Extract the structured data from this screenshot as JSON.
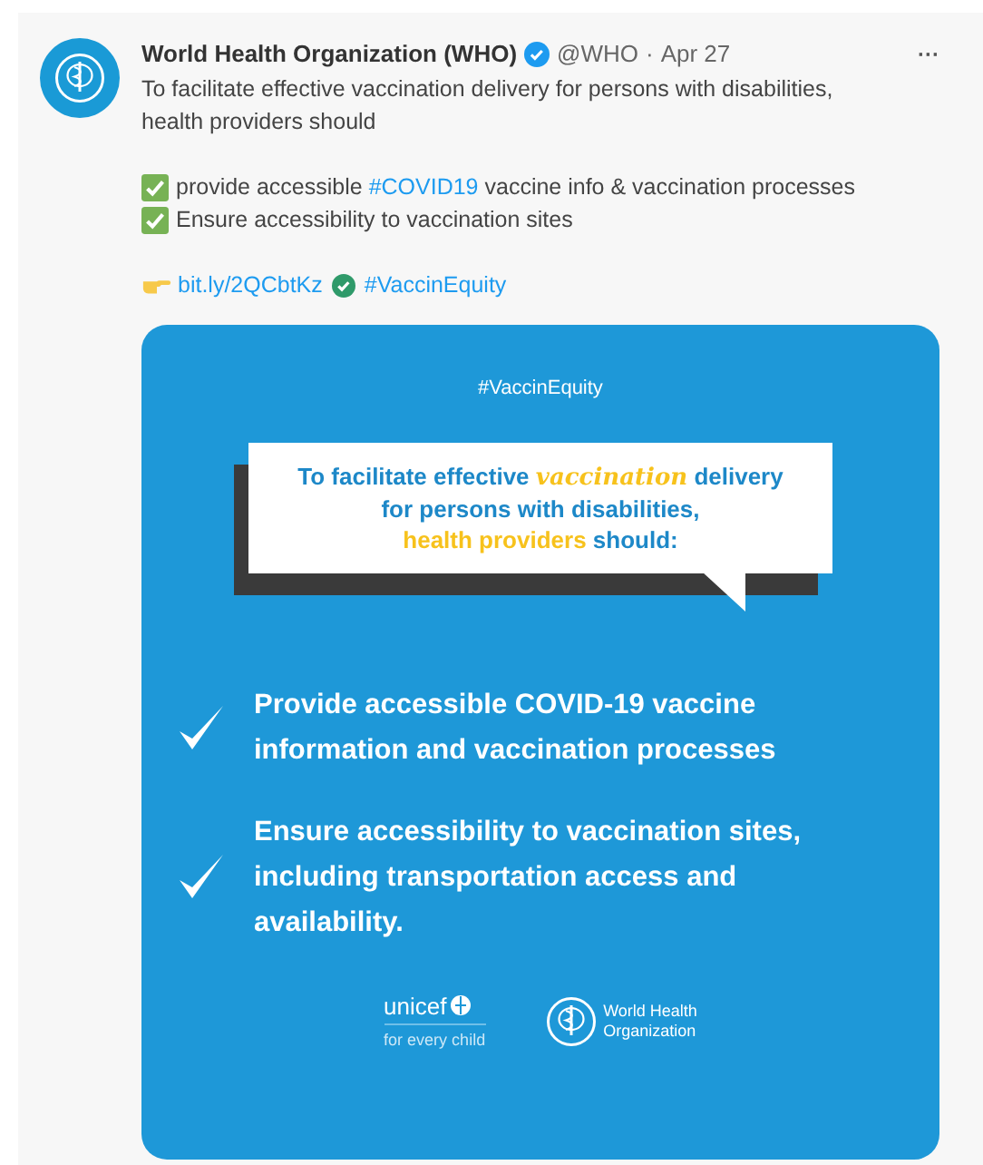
{
  "tweet": {
    "author": "World Health Organization (WHO)",
    "verified": true,
    "handle": "@WHO",
    "separator": "·",
    "date": "Apr 27",
    "more": "···",
    "intro": "To facilitate effective vaccination delivery for persons with disabilities, health providers should",
    "checklist": [
      [
        {
          "kind": "plain",
          "text": "provide accessible "
        },
        {
          "kind": "hashtag",
          "text": "#COVID19"
        },
        {
          "kind": "plain",
          "text": " vaccine info & vaccination processes"
        }
      ],
      [
        {
          "kind": "plain",
          "text": "Ensure accessibility to vaccination sites"
        }
      ]
    ],
    "link": "bit.ly/2QCbtKz",
    "hashtag": "#VaccinEquity"
  },
  "graphic": {
    "hashtag": "#VaccinEquity",
    "bubble_lines": [
      [
        {
          "kind": "plain",
          "text": "To facilitate effective "
        },
        {
          "kind": "script",
          "text": "vaccination"
        },
        {
          "kind": "plain",
          "text": " delivery"
        }
      ],
      [
        {
          "kind": "plain",
          "text": "for persons with disabilities,"
        }
      ],
      [
        {
          "kind": "yellow",
          "text": "health providers"
        },
        {
          "kind": "plain",
          "text": " should:"
        }
      ]
    ],
    "items": [
      "Provide accessible COVID-19 vaccine information and vaccination processes",
      "Ensure accessibility to vaccination sites, including transportation access and availability."
    ],
    "unicef": {
      "name": "unicef",
      "tagline": "for every child"
    },
    "who": {
      "line1": "World Health",
      "line2": "Organization"
    }
  }
}
